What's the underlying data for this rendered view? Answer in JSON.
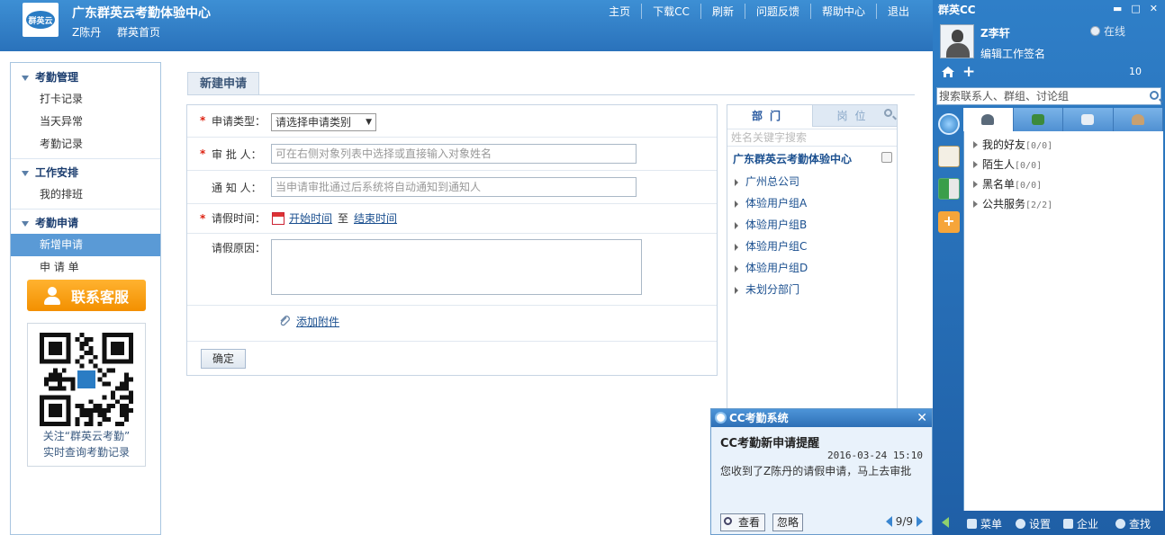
{
  "header": {
    "logo_text": "群英云",
    "title": "广东群英云考勤体验中心",
    "user": "Z陈丹",
    "home_link": "群英首页",
    "nav": [
      "主页",
      "下载CC",
      "刷新",
      "问题反馈",
      "帮助中心",
      "退出"
    ]
  },
  "sidebar": {
    "groups": [
      {
        "title": "考勤管理",
        "items": [
          "打卡记录",
          "当天异常",
          "考勤记录"
        ]
      },
      {
        "title": "工作安排",
        "items": [
          "我的排班"
        ]
      },
      {
        "title": "考勤申请",
        "items": [
          "新增申请",
          "申 请 单"
        ]
      }
    ],
    "active_item": "新增申请",
    "contact_button": "联系客服",
    "qr_caption_line1": "关注“群英云考勤”",
    "qr_caption_line2": "实时查询考勤记录"
  },
  "form": {
    "title": "新建申请",
    "type_label": "申请类型：",
    "type_select": "请选择申请类别",
    "approver_label": "审 批 人：",
    "approver_placeholder": "可在右侧对象列表中选择或直接输入对象姓名",
    "notify_label": "通 知 人：",
    "notify_placeholder": "当申请审批通过后系统将自动通知到通知人",
    "time_label": "请假时间：",
    "start_time": "开始时间",
    "to_text": "至",
    "end_time": "结束时间",
    "reason_label": "请假原因：",
    "attach_link": "添加附件",
    "ok_button": "确定",
    "required_mark": "*"
  },
  "org_panel": {
    "tab_dept": "部门",
    "tab_position": "岗位",
    "search_placeholder": "姓名关键字搜索",
    "root": "广东群英云考勤体验中心",
    "items": [
      "广州总公司",
      "体验用户组A",
      "体验用户组B",
      "体验用户组C",
      "体验用户组D",
      "未划分部门"
    ]
  },
  "popup": {
    "app_title": "CC考勤系统",
    "title": "CC考勤新申请提醒",
    "time": "2016-03-24 15:10",
    "message": "您收到了Z陈丹的请假申请，马上去审批",
    "view_button": "查看",
    "ignore_button": "忽略",
    "pager": "9/9",
    "close": "✕"
  },
  "cc": {
    "app_title": "群英CC",
    "window_buttons": [
      "▬",
      "□",
      "✕"
    ],
    "user_name": "Z李轩",
    "status": "在线",
    "signature": "编辑工作签名",
    "count": "10",
    "search_placeholder": "搜索联系人、群组、讨论组",
    "contacts": [
      {
        "name": "我的好友",
        "count": "[0/0]"
      },
      {
        "name": "陌生人",
        "count": "[0/0]"
      },
      {
        "name": "黑名单",
        "count": "[0/0]"
      },
      {
        "name": "公共服务",
        "count": "[2/2]"
      }
    ],
    "bottom": [
      "菜单",
      "设置",
      "企业",
      "查找"
    ]
  },
  "colors": {
    "header_blue": "#2a72bb",
    "active_nav": "#5a9ad6",
    "contact_orange": "#f39000",
    "required_red": "#dd1111",
    "link_blue": "#1a4f8f"
  }
}
